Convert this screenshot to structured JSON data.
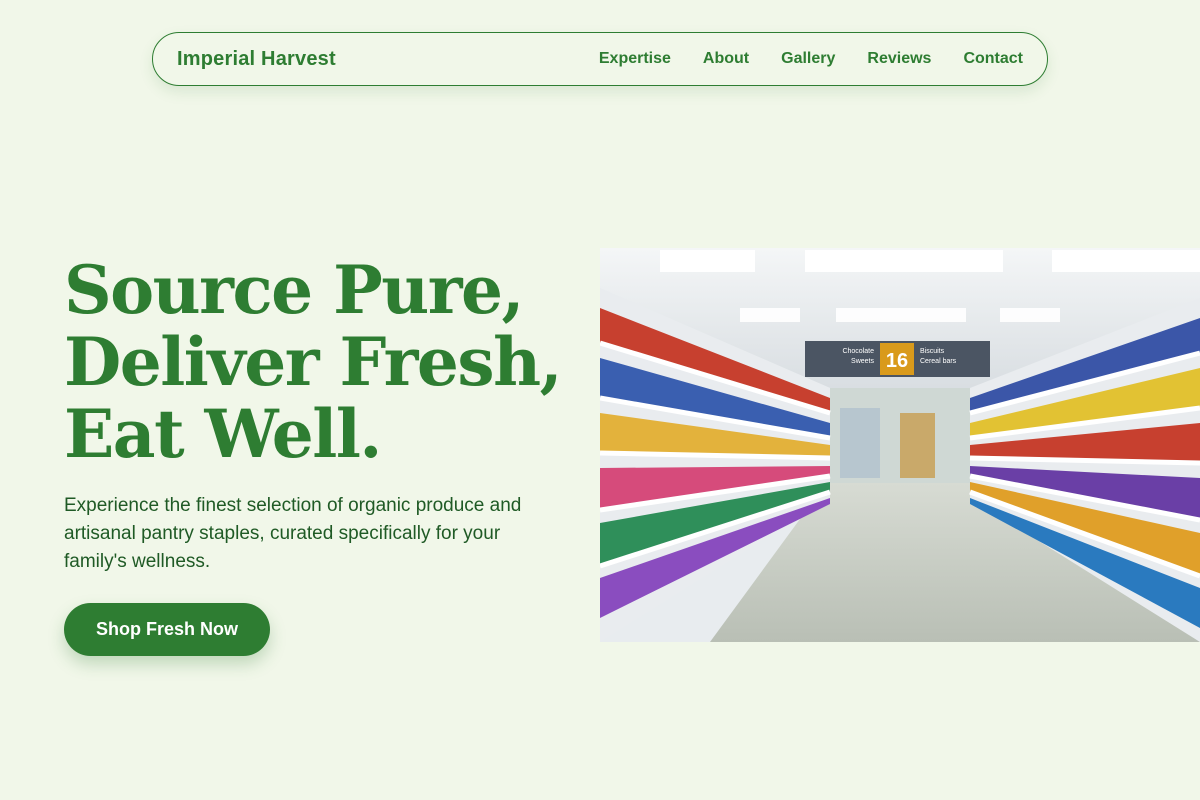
{
  "header": {
    "brand": "Imperial Harvest",
    "nav": [
      "Expertise",
      "About",
      "Gallery",
      "Reviews",
      "Contact"
    ]
  },
  "hero": {
    "headline_lines": [
      "Source Pure,",
      "Deliver Fresh,",
      "Eat Well."
    ],
    "subtext": "Experience the finest selection of organic produce and artisanal pantry staples, curated specifically for your family's wellness.",
    "cta_label": "Shop Fresh Now",
    "image": {
      "description": "supermarket aisle with stocked shelves",
      "sign_left": [
        "Chocolate",
        "Sweets"
      ],
      "sign_number": "16",
      "sign_right": [
        "Biscuits",
        "Cereal bars"
      ]
    }
  },
  "colors": {
    "background": "#f1f7e9",
    "accent": "#2e7d32",
    "text_dark": "#1f5a25"
  }
}
